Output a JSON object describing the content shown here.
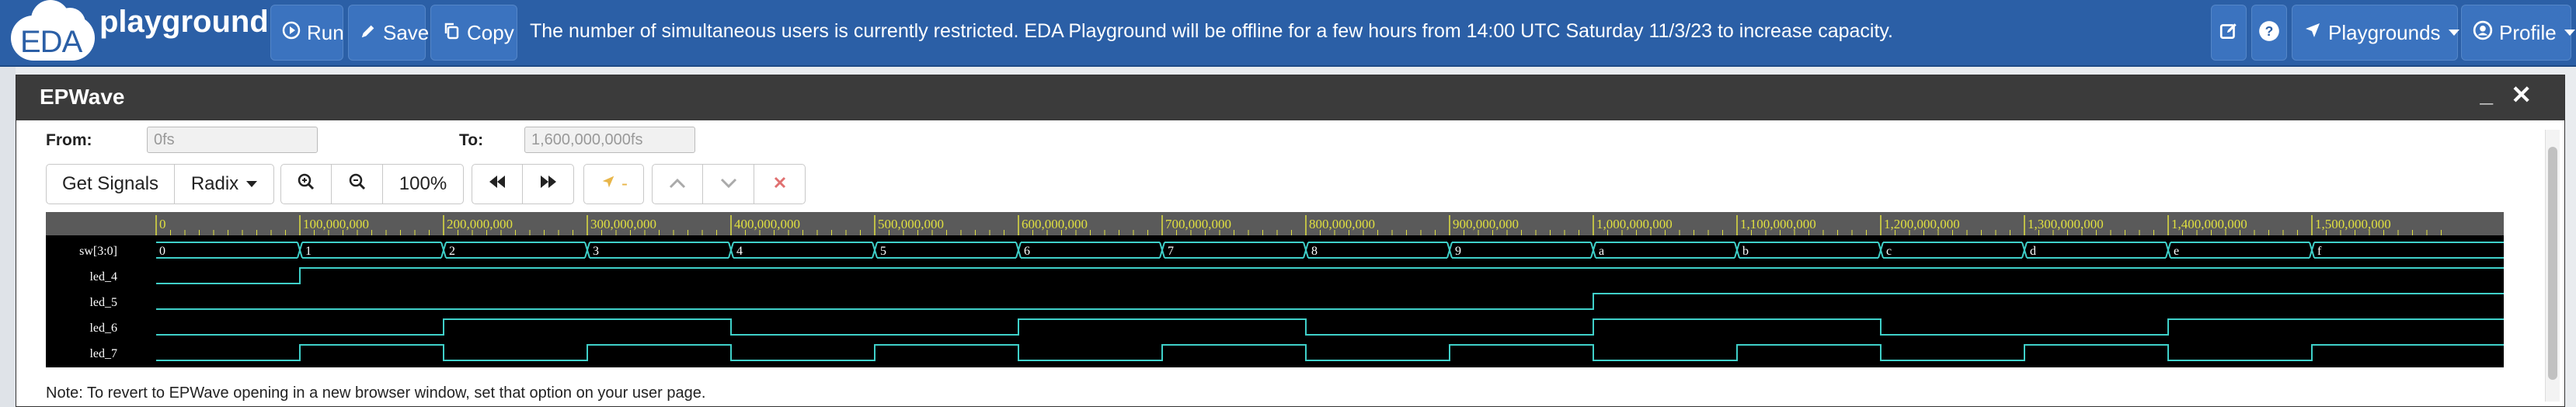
{
  "app": {
    "logo_eda": "EDA",
    "logo_playground": "playground"
  },
  "navbar": {
    "run_label": "Run",
    "save_label": "Save",
    "copy_label": "Copy",
    "message": "The number of simultaneous users is currently restricted. EDA Playground will be offline for a few hours from 14:00 UTC Saturday 11/3/23 to increase capacity.",
    "playgrounds_label": "Playgrounds",
    "profile_label": "Profile",
    "icons": [
      "play-icon",
      "pencil-icon",
      "copy-icon",
      "edit-icon",
      "help-icon",
      "rocket-icon",
      "user-icon"
    ],
    "accent_color": "#2b5fa6"
  },
  "epwave": {
    "title": "EPWave",
    "minimize_symbol": "_",
    "close_symbol": "✕",
    "from_label": "From:",
    "from_placeholder": "0fs",
    "to_label": "To:",
    "to_placeholder": "1,600,000,000fs",
    "toolbar": {
      "get_signals_label": "Get Signals",
      "radix_label": "Radix",
      "zoom_level": "100%",
      "marker_label": "-"
    },
    "timeline_ticks": [
      "0",
      "100,000,000",
      "200,000,000",
      "300,000,000",
      "400,000,000",
      "500,000,000",
      "600,000,000",
      "700,000,000",
      "800,000,000",
      "900,000,000",
      "1,000,000,000",
      "1,100,000,000",
      "1,200,000,000",
      "1,300,000,000",
      "1,400,000,000",
      "1,500,000,000"
    ],
    "signals": [
      {
        "name": "sw[3:0]",
        "type": "bus",
        "values": [
          "0",
          "1",
          "2",
          "3",
          "4",
          "5",
          "6",
          "7",
          "8",
          "9",
          "a",
          "b",
          "c",
          "d",
          "e",
          "f"
        ]
      },
      {
        "name": "led_4",
        "type": "bit",
        "values": [
          0,
          1,
          1,
          1,
          1,
          1,
          1,
          1,
          1,
          1,
          1,
          1,
          1,
          1,
          1,
          1
        ]
      },
      {
        "name": "led_5",
        "type": "bit",
        "values": [
          0,
          0,
          0,
          0,
          0,
          0,
          0,
          0,
          0,
          0,
          1,
          1,
          1,
          1,
          1,
          1
        ]
      },
      {
        "name": "led_6",
        "type": "bit",
        "values": [
          0,
          0,
          1,
          1,
          0,
          0,
          1,
          1,
          0,
          0,
          1,
          1,
          0,
          0,
          1,
          1
        ]
      },
      {
        "name": "led_7",
        "type": "bit",
        "values": [
          0,
          1,
          0,
          1,
          0,
          1,
          0,
          1,
          0,
          1,
          0,
          1,
          0,
          1,
          0,
          1
        ]
      }
    ],
    "note": "Note: To revert to EPWave opening in a new browser window, set that option on your user page.",
    "colors": {
      "wave": "#3fd0c9",
      "bus_text": "#ffffff",
      "tick_text": "#e0e040",
      "label_text": "#ffffff"
    }
  }
}
